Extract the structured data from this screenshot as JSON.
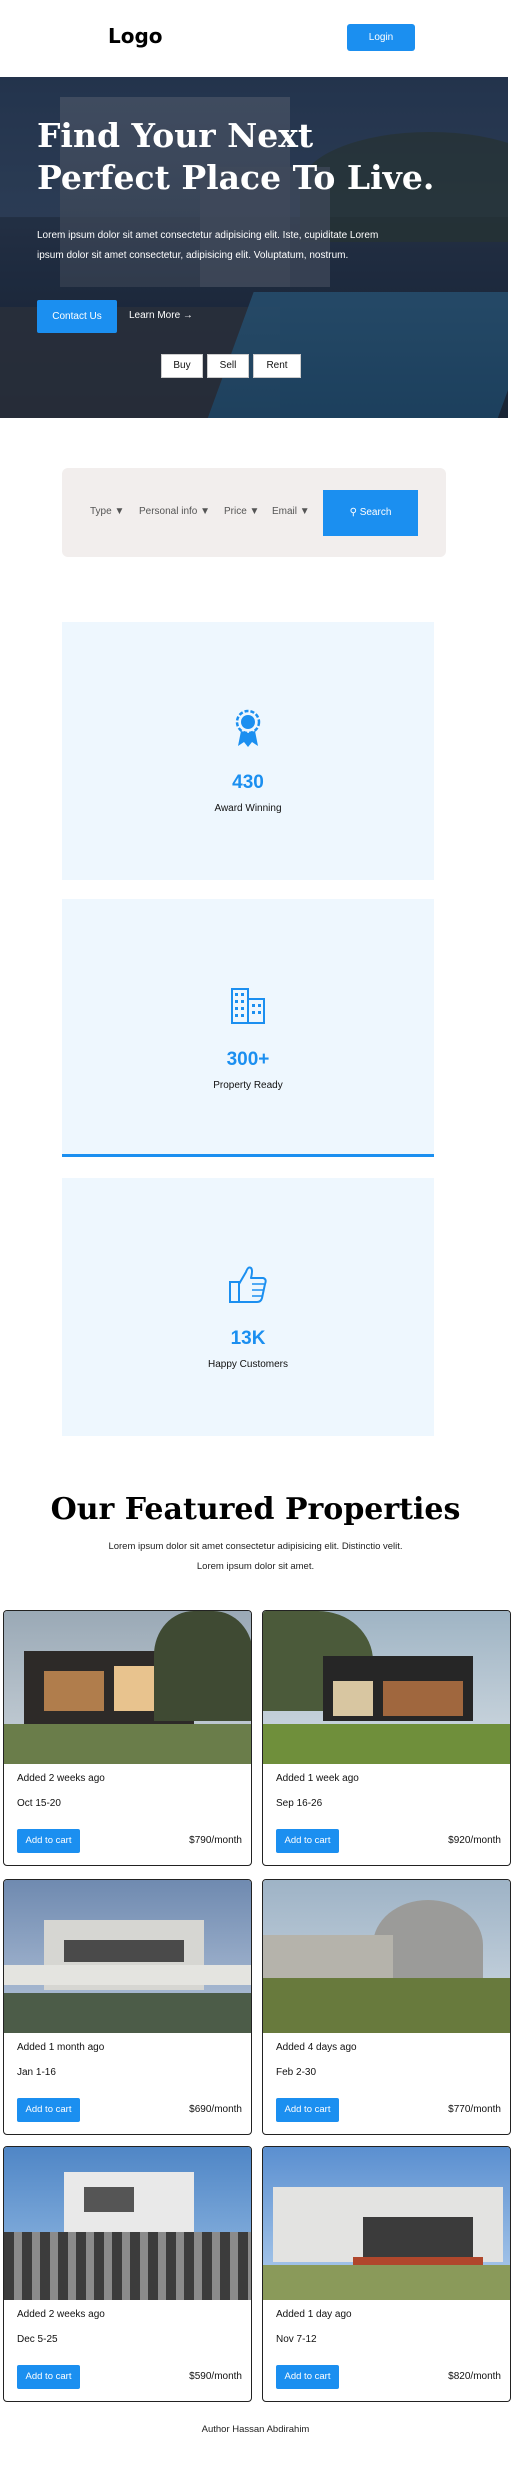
{
  "header": {
    "logo": "Logo",
    "login_label": "Login"
  },
  "hero": {
    "title": "Find Your Next Perfect Place To Live.",
    "text": "Lorem ipsum dolor sit amet consectetur adipisicing elit. Iste, cupiditate Lorem ipsum dolor sit amet consectetur, adipisicing elit. Voluptatum, nostrum.",
    "contact_label": "Contact Us",
    "learn_label": "Learn More →",
    "tabs": [
      "Buy",
      "Sell",
      "Rent"
    ]
  },
  "search": {
    "filters": [
      "Type ▼",
      "Personal info ▼",
      "Price ▼",
      "Email ▼"
    ],
    "button_label": "⚲ Search"
  },
  "stats": [
    {
      "value": "430",
      "label": "Award Winning",
      "icon": "award-icon"
    },
    {
      "value": "300+",
      "label": "Property Ready",
      "icon": "buildings-icon"
    },
    {
      "value": "13K",
      "label": "Happy Customers",
      "icon": "thumbs-up-icon"
    }
  ],
  "featured": {
    "title": "Our Featured Properties",
    "subtitle": "Lorem ipsum dolor sit amet consectetur adipisicing elit. Distinctio velit. Lorem ipsum dolor sit amet."
  },
  "properties": [
    {
      "added": "Added 2 weeks ago",
      "dates": "Oct 15-20",
      "button": "Add to cart",
      "price": "$790/month"
    },
    {
      "added": "Added 1 week ago",
      "dates": "Sep 16-26",
      "button": "Add to cart",
      "price": "$920/month"
    },
    {
      "added": "Added 1 month ago",
      "dates": "Jan 1-16",
      "button": "Add to cart",
      "price": "$690/month"
    },
    {
      "added": "Added 4 days ago",
      "dates": "Feb 2-30",
      "button": "Add to cart",
      "price": "$770/month"
    },
    {
      "added": "Added 2 weeks ago",
      "dates": "Dec 5-25",
      "button": "Add to cart",
      "price": "$590/month"
    },
    {
      "added": "Added 1 day ago",
      "dates": "Nov 7-12",
      "button": "Add to cart",
      "price": "$820/month"
    }
  ],
  "footer": {
    "text": "Author Hassan Abdirahim"
  },
  "colors": {
    "accent": "#1b8ff0",
    "stat_bg": "#eef7fe",
    "search_bg": "#f2eeed"
  }
}
